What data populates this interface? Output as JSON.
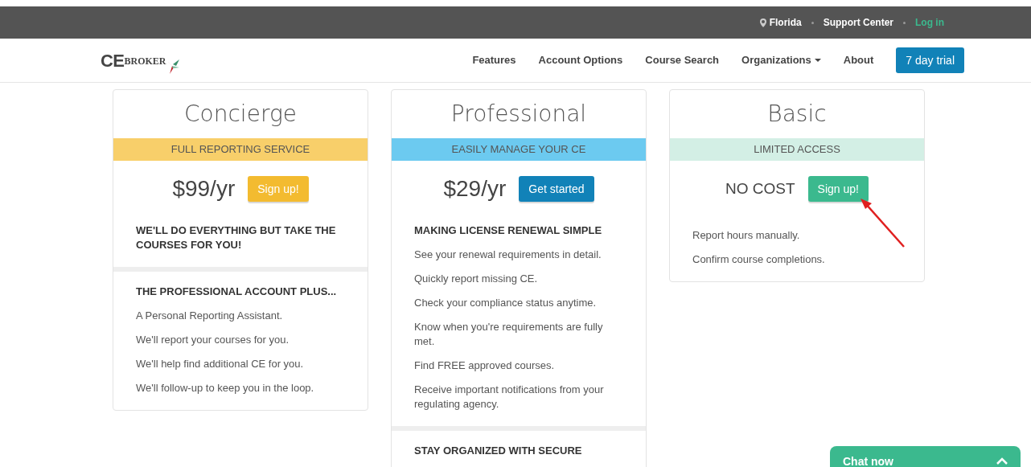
{
  "top_bar": {
    "location": "Florida",
    "links": [
      {
        "label": "Support Center",
        "kind": "plain"
      },
      {
        "label": "Log in",
        "kind": "accent"
      }
    ]
  },
  "nav": {
    "logo": "CE",
    "logo_small": "BROKER",
    "items": [
      {
        "label": "Features",
        "dropdown": false
      },
      {
        "label": "Account Options",
        "dropdown": false
      },
      {
        "label": "Course Search",
        "dropdown": false
      },
      {
        "label": "Organizations",
        "dropdown": true
      },
      {
        "label": "About",
        "dropdown": false
      }
    ],
    "trial_button": "7 day trial"
  },
  "plans": [
    {
      "title": "Concierge",
      "tagline": "FULL REPORTING SERVICE",
      "color": "#f8cf6a",
      "price": "$99/yr",
      "button": {
        "label": "Sign up!",
        "color": "#f3bb30"
      },
      "annotated": false,
      "sections": [
        {
          "heading": "WE'LL DO EVERYTHING BUT TAKE THE COURSES FOR YOU!"
        },
        {
          "heading": "THE PROFESSIONAL ACCOUNT PLUS...",
          "items": [
            "A Personal Reporting Assistant.",
            "We'll report your courses for you.",
            "We'll help find additional CE for you.",
            "We'll follow-up to keep you in the loop."
          ]
        }
      ]
    },
    {
      "title": "Professional",
      "tagline": "EASILY MANAGE YOUR CE",
      "color": "#6ccaf0",
      "price": "$29/yr",
      "button": {
        "label": "Get started",
        "color": "#1182b8"
      },
      "annotated": false,
      "sections": [
        {
          "heading": "MAKING LICENSE RENEWAL SIMPLE",
          "items": [
            "See your renewal requirements in detail.",
            "Quickly report missing CE.",
            "Check your compliance status anytime.",
            "Know when you're requirements are fully met.",
            "Find FREE approved courses.",
            "Receive important notifications from your regulating agency."
          ]
        },
        {
          "heading": "STAY ORGANIZED WITH SECURE"
        }
      ]
    },
    {
      "title": "Basic",
      "tagline": "LIMITED ACCESS",
      "color": "#d3efe5",
      "price": "NO COST",
      "button": {
        "label": "Sign up!",
        "color": "#3bb98e"
      },
      "annotated": true,
      "sections": [
        {
          "items": [
            "Report hours manually.",
            "Confirm course completions."
          ]
        }
      ]
    }
  ],
  "chat": {
    "label": "Chat now"
  }
}
